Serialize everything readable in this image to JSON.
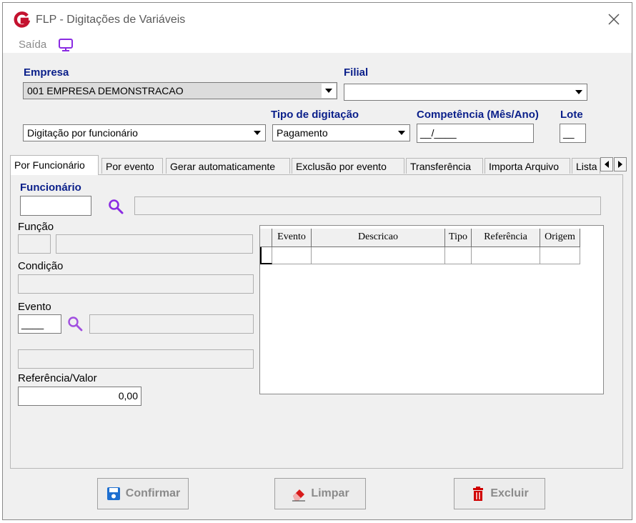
{
  "window": {
    "title": "FLP - Digitações de Variáveis"
  },
  "menu": {
    "saida": "Saída"
  },
  "form": {
    "empresa_label": "Empresa",
    "empresa_value": "001 EMPRESA DEMONSTRACAO",
    "filial_label": "Filial",
    "filial_value": "",
    "modo_value": "Digitação por funcionário",
    "tipo_label": "Tipo de digitação",
    "tipo_value": "Pagamento",
    "competencia_label": "Competência (Mês/Ano)",
    "competencia_value": "__/____",
    "lote_label": "Lote",
    "lote_value": "__"
  },
  "tabs": [
    {
      "label": "Por Funcionário",
      "active": true
    },
    {
      "label": "Por evento"
    },
    {
      "label": "Gerar automaticamente"
    },
    {
      "label": "Exclusão por evento"
    },
    {
      "label": "Transferência"
    },
    {
      "label": "Importa Arquivo"
    },
    {
      "label": "Lista"
    }
  ],
  "panel": {
    "funcionario_label": "Funcionário",
    "funcao_label": "Função",
    "condicao_label": "Condição",
    "evento_label": "Evento",
    "evento_value": "____",
    "referencia_label": "Referência/Valor",
    "referencia_value": "0,00"
  },
  "grid": {
    "columns": [
      "Evento",
      "Descricao",
      "Tipo",
      "Referência",
      "Origem"
    ]
  },
  "buttons": {
    "confirmar": "Confirmar",
    "limpar": "Limpar",
    "excluir": "Excluir"
  },
  "colors": {
    "label_blue": "#0a1f8a",
    "icon_purple": "#8a2be2",
    "logo_red": "#c4122f",
    "excluir_red": "#d00000"
  }
}
